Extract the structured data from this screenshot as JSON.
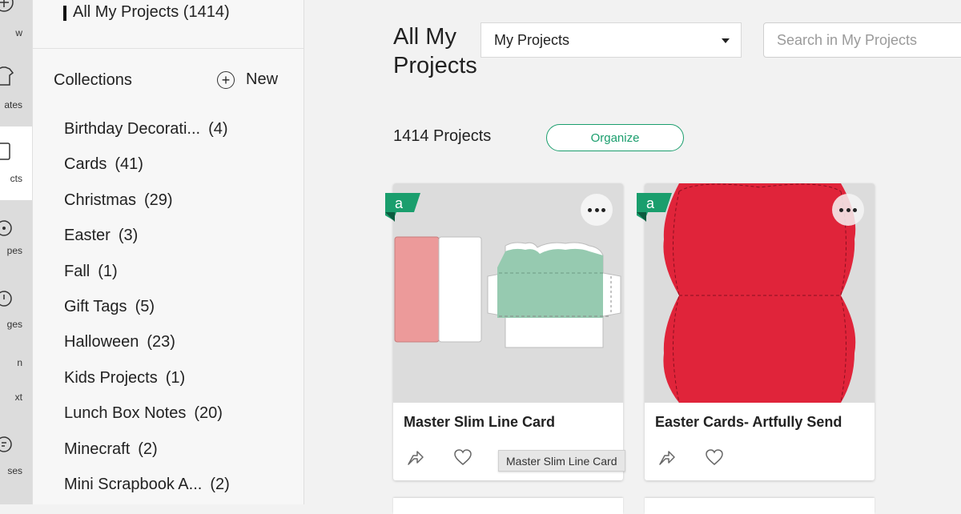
{
  "rail": {
    "items": [
      {
        "label": "w",
        "icon": "view-icon"
      },
      {
        "label": "ates",
        "icon": "templates-icon"
      },
      {
        "label": "cts",
        "icon": "projects-icon"
      },
      {
        "label": "pes",
        "icon": "shapes-icon"
      },
      {
        "label": "ges",
        "icon": "images-icon"
      },
      {
        "label": "n",
        "icon": "text-icon"
      },
      {
        "label": "xt",
        "icon": "text-icon"
      },
      {
        "label": "ses",
        "icon": "phrases-icon"
      }
    ]
  },
  "sidebar": {
    "all_projects_label": "All My Projects (1414)",
    "collections_title": "Collections",
    "new_label": "New",
    "collections": [
      {
        "name": "Birthday Decorati...",
        "count": "(4)"
      },
      {
        "name": "Cards",
        "count": "(41)"
      },
      {
        "name": "Christmas",
        "count": "(29)"
      },
      {
        "name": "Easter",
        "count": "(3)"
      },
      {
        "name": "Fall",
        "count": "(1)"
      },
      {
        "name": "Gift Tags",
        "count": "(5)"
      },
      {
        "name": "Halloween",
        "count": "(23)"
      },
      {
        "name": "Kids Projects",
        "count": "(1)"
      },
      {
        "name": "Lunch Box Notes",
        "count": "(20)"
      },
      {
        "name": "Minecraft",
        "count": "(2)"
      },
      {
        "name": "Mini Scrapbook A...",
        "count": "(2)"
      }
    ]
  },
  "main": {
    "page_title": "All My Projects",
    "filter_select": {
      "selected": "My Projects"
    },
    "search": {
      "placeholder": "Search in My Projects",
      "value": ""
    },
    "project_count": "1414 Projects",
    "organize_label": "Organize",
    "cards": [
      {
        "title": "Master Slim Line Card",
        "badge": "a"
      },
      {
        "title": "Easter Cards- Artfully Send",
        "badge": "a"
      }
    ],
    "tooltip": "Master Slim Line Card"
  },
  "colors": {
    "accent_green": "#1a9e6d",
    "badge_green": "#1a9e6d",
    "card_red": "#e0243a",
    "envelope_green": "#96cab0",
    "card_pink": "#ec9a9a"
  }
}
